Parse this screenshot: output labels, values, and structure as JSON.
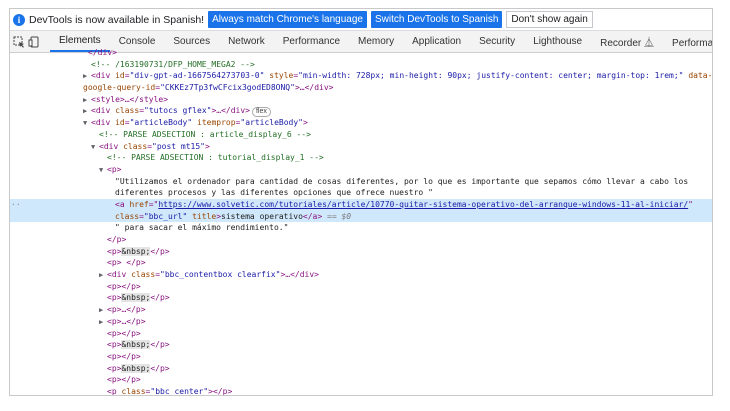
{
  "infobar": {
    "message": "DevTools is now available in Spanish!",
    "btn_match": "Always match Chrome's language",
    "btn_switch": "Switch DevTools to Spanish",
    "btn_dismiss": "Don't show again"
  },
  "tabs": [
    "Elements",
    "Console",
    "Sources",
    "Network",
    "Performance",
    "Memory",
    "Application",
    "Security",
    "Lighthouse",
    "Recorder ⏅",
    "Performance insights ⏅"
  ],
  "tree": {
    "r0": "</div>",
    "r1_comment": "<!-- /163190731/DFP_HOME_MEGA2 -->",
    "r2_tag_open": "<div ",
    "r2_a1": "id",
    "r2_v1": "\"div-gpt-ad-1667564273703-0\"",
    "r2_a2": "style",
    "r2_v2": "\"min-width: 728px; min-height: 90px; justify-content: center; margin-top: 1rem;\"",
    "r2_a3": "data-",
    "r3_a": "google-query-id",
    "r3_v": "\"CKKEz7Tp3fwCFcix3godED8ONQ\"",
    "r3_tail": ">…</div>",
    "r4": "<style>…</style>",
    "r5_open": "<div ",
    "r5_a": "class",
    "r5_v": "\"tutocs gflex\"",
    "r5_tail": ">…</div>",
    "r5_badge": "flex",
    "r6_open": "<div ",
    "r6_a1": "id",
    "r6_v1": "\"articleBody\"",
    "r6_a2": "itemprop",
    "r6_v2": "\"articleBody\"",
    "r6_tail": ">",
    "r7_comment": "<!-- PARSE ADSECTION : article_display_6 -->",
    "r8_open": "<div ",
    "r8_a": "class",
    "r8_v": "\"post mt15\"",
    "r8_tail": ">",
    "r9_comment": "<!-- PARSE ADSECTION : tutorial_display_1 -->",
    "r10": "<p>",
    "r11": "\"Utilizamos el ordenador para cantidad de cosas diferentes, por lo que es importante que sepamos cómo llevar a cabo los",
    "r12": "diferentes procesos y las diferentes opciones que ofrece nuestro \"",
    "r13_open": "<a ",
    "r13_a": "href",
    "r13_link": "https://www.solvetic.com/tutoriales/article/10770-quitar-sistema-operativo-del-arranque-windows-11-al-iniciar/",
    "r14_a": "class",
    "r14_v": "\"bbc_url\"",
    "r14_a2": "title",
    "r14_text": "sistema operativo",
    "r14_close": "</a>",
    "r14_eq": " == $0",
    "r15": "\" para sacar el máximo rendimiento.\"",
    "r16": "</p>",
    "nbsp": "&nbsp;",
    "p_open": "<p>",
    "p_close": "</p>",
    "p_empty": "<p> </p>",
    "r19_open": "<div ",
    "r19_a": "class",
    "r19_v": "\"bbc_contentbox clearfix\"",
    "r19_tail": ">…</div>",
    "p_collapsed": "<p>…</p>",
    "p_pair": "<p></p>",
    "r28_open": "<p ",
    "r28_a": "class",
    "r28_v": "\"bbc_center\"",
    "r28_tail": "></p>"
  }
}
